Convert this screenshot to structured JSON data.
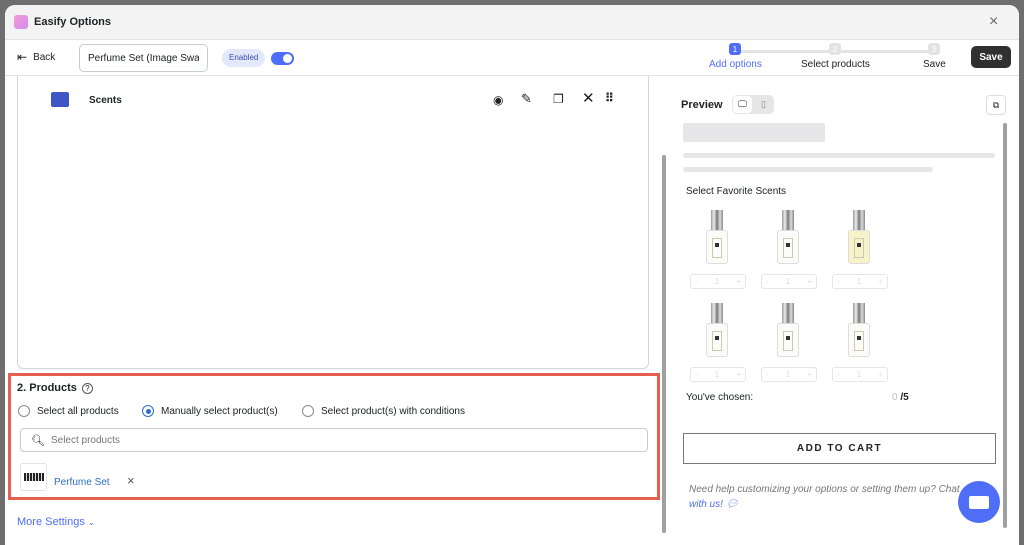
{
  "window": {
    "title": "Easify Options",
    "close": "×"
  },
  "toolbar": {
    "back_label": "Back",
    "name_value": "Perfume Set (Image Swatch)",
    "status_badge": "Enabled",
    "toggle_on": true,
    "save_label": "Save",
    "steps": [
      {
        "num": "1",
        "label": "Add options",
        "active": true
      },
      {
        "num": "2",
        "label": "Select products",
        "active": false
      },
      {
        "num": "3",
        "label": "Save",
        "active": false
      }
    ]
  },
  "option_row": {
    "label": "Scents",
    "icons": [
      "eye-icon",
      "edit-icon",
      "duplicate-icon",
      "close-icon",
      "drag-handle-icon"
    ]
  },
  "products": {
    "title": "2. Products",
    "help": "?",
    "radios": [
      {
        "label": "Select all products",
        "checked": false
      },
      {
        "label": "Manually select product(s)",
        "checked": true
      },
      {
        "label": "Select product(s) with conditions",
        "checked": false
      }
    ],
    "search_placeholder": "Select products",
    "selected": [
      {
        "name": "Perfume Set",
        "remove": "×"
      }
    ]
  },
  "more_settings": "More Settings",
  "preview": {
    "title": "Preview",
    "option_title": "Select Favorite Scents",
    "stepper": {
      "minus": "-",
      "value": "1",
      "plus": "+"
    },
    "chosen_label": "You've chosen:",
    "chosen_count": "0",
    "chosen_max": "/5",
    "add_to_cart": "ADD TO CART",
    "help_text": "Need help customizing your options or setting them up? Chat",
    "help_link": "with us!"
  },
  "colors": {
    "accent": "#4f6ef7",
    "highlight_border": "#e45f4f",
    "link": "#2c6ecb"
  }
}
